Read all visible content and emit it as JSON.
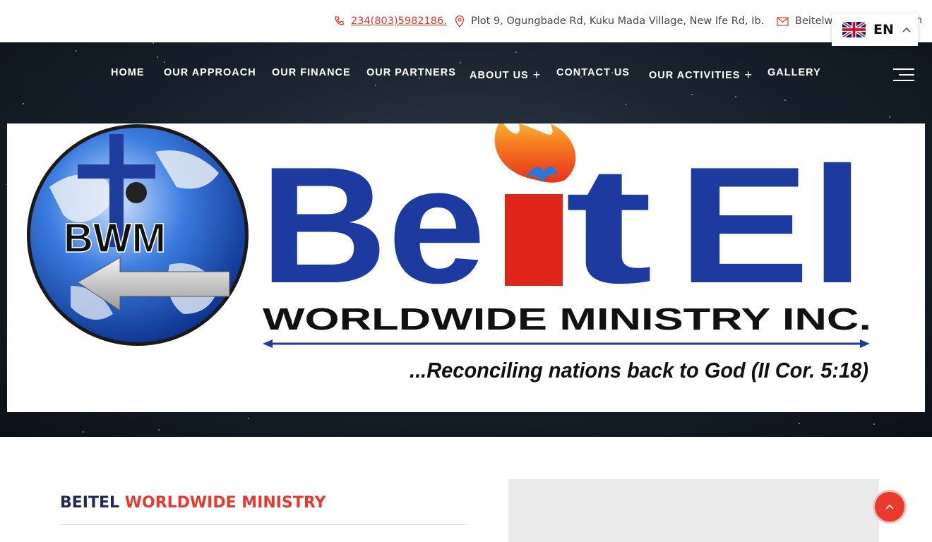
{
  "topbar": {
    "phone": "234(803)5982186.",
    "address": "Plot 9, Ogungbade Rd, Kuku Mada Village, New Ife Rd, Ib.",
    "email": "Beitelwo",
    "email_tail": "m",
    "icons": [
      "phone-icon",
      "map-pin-icon",
      "envelope-icon"
    ]
  },
  "language": {
    "code": "EN",
    "flag": "uk-flag-icon"
  },
  "nav": {
    "items": [
      {
        "label": "HOME"
      },
      {
        "label": "OUR APPROACH"
      },
      {
        "label": "OUR FINANCE"
      },
      {
        "label": "OUR PARTNERS"
      },
      {
        "label": "ABOUT US",
        "expand": "+"
      },
      {
        "label": "CONTACT US"
      },
      {
        "label": "OUR ACTIVITIES",
        "expand": "+"
      },
      {
        "label": "GALLERY"
      }
    ]
  },
  "banner": {
    "logo_text": "BWM",
    "title_b": "Be",
    "title_i": "i",
    "title_t": "t",
    "title_el": "El",
    "subtitle": "WORLDWIDE MINISTRY INC.",
    "tagline": "...Reconciling nations back to God (II Cor. 5:18)"
  },
  "section": {
    "title_plain": "BEITEL",
    "title_accent": "WORLDWIDE MINISTRY"
  },
  "colors": {
    "accent_red": "#e63a2e",
    "navy": "#1e2a55",
    "title_blue": "#1c3aa0",
    "hero_dark": "#16202a"
  }
}
